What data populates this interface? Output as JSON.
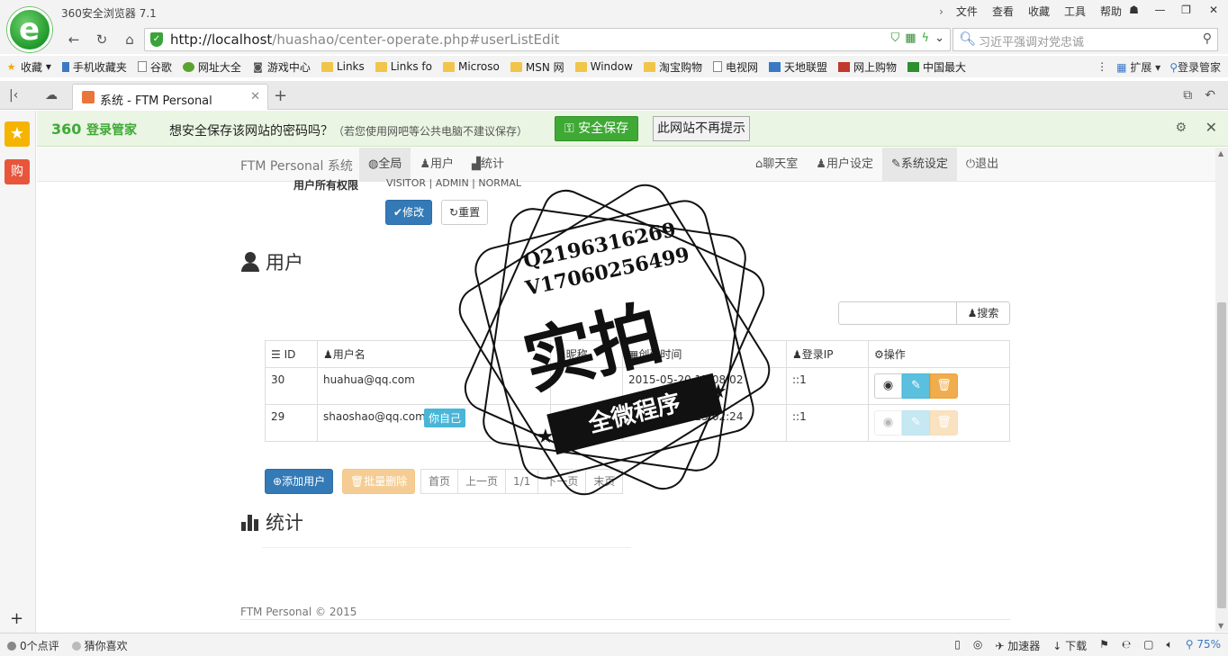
{
  "browser": {
    "title": "360安全浏览器 7.1",
    "logo_letter": "e",
    "menu": [
      "文件",
      "查看",
      "收藏",
      "工具",
      "帮助"
    ],
    "url_host": "http://localhost",
    "url_path": "/huashao/center-operate.php#userListEdit",
    "search_placeholder": "习近平强调对党忠诚",
    "bookmarks": [
      "收藏",
      "手机收藏夹",
      "谷歌",
      "网址大全",
      "游戏中心",
      "Links",
      "Links fo",
      "Microso",
      "MSN 网",
      "Window",
      "淘宝购物",
      "电视网",
      "天地联盟",
      "网上购物",
      "中国最大"
    ],
    "bookmarks_right": [
      "扩展",
      "登录管家"
    ],
    "tab_title": "系统 - FTM Personal"
  },
  "sidebar": {
    "shop_label": "购"
  },
  "password_bar": {
    "logo": "360",
    "logo_suffix": "登录管家",
    "question": "想安全保存该网站的密码吗？",
    "note": "（若您使用网吧等公共电脑不建议保存）",
    "save_label": "安全保存",
    "never_label": "此网站不再提示"
  },
  "navbar": {
    "brand": "FTM Personal 系统",
    "left": [
      "全局",
      "用户",
      "统计"
    ],
    "right": [
      "聊天室",
      "用户设定",
      "系统设定",
      "退出"
    ]
  },
  "permissions": {
    "label": "用户所有权限",
    "value": "VISITOR | ADMIN | NORMAL"
  },
  "buttons": {
    "modify": "修改",
    "reset": "重置",
    "search": "搜索",
    "add_user": "添加用户",
    "batch_delete": "批量删除"
  },
  "users_section": {
    "title": "用户",
    "columns": [
      "ID",
      "用户名",
      "昵称",
      "创建时间",
      "登录IP",
      "操作"
    ],
    "rows": [
      {
        "id": "30",
        "username": "huahua@qq.com",
        "nickname": "",
        "created": "2015-05-20 15:08:02",
        "ip": "::1"
      },
      {
        "id": "29",
        "username": "shaoshao@qq.com",
        "nickname": "",
        "created": "2015-05-20 15:02:24",
        "ip": "::1"
      }
    ],
    "tooltip": "你自己"
  },
  "pager": [
    "首页",
    "上一页",
    "1/1",
    "下一页",
    "末页"
  ],
  "stats_section": {
    "title": "统计"
  },
  "footer": "FTM Personal © 2015",
  "watermark": {
    "line1": "Q2196316269",
    "line2": "V17060256499",
    "big": "实拍",
    "ribbon": "全微程序"
  },
  "statusbar": {
    "left": [
      "0个点评",
      "猜你喜欢"
    ],
    "accelerator": "加速器",
    "download": "下载",
    "zoom": "75%"
  }
}
